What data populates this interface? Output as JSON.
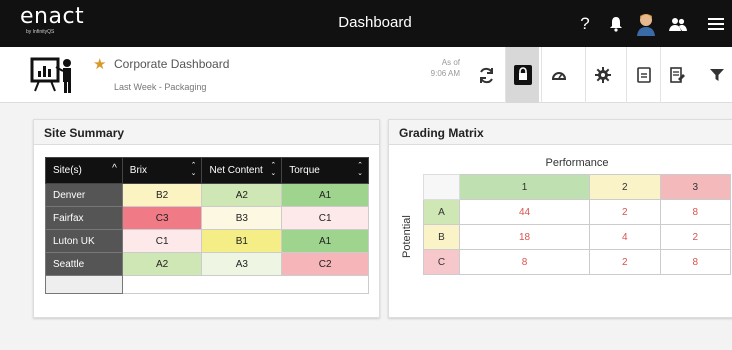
{
  "app": {
    "logo": "enact",
    "logo_sub": "by InfinityQS",
    "title": "Dashboard"
  },
  "top_icons": [
    "help-icon",
    "bell-icon",
    "user-avatar",
    "team-icon",
    "menu-icon"
  ],
  "subheader": {
    "name": "Corporate Dashboard",
    "filter": "Last Week - Packaging",
    "asof_label": "As of",
    "asof_time": "9:06 AM"
  },
  "site_summary": {
    "title": "Site Summary",
    "columns": [
      "Site(s)",
      "Brix",
      "Net Content",
      "Torque"
    ],
    "rows": [
      {
        "site": "Denver",
        "cells": [
          {
            "v": "B2",
            "c": "#fbf3c2"
          },
          {
            "v": "A2",
            "c": "#cfe6b5"
          },
          {
            "v": "A1",
            "c": "#9fd48f"
          }
        ]
      },
      {
        "site": "Fairfax",
        "cells": [
          {
            "v": "C3",
            "c": "#f07b86"
          },
          {
            "v": "B3",
            "c": "#fdf8e2"
          },
          {
            "v": "C1",
            "c": "#fde8ea"
          }
        ]
      },
      {
        "site": "Luton UK",
        "cells": [
          {
            "v": "C1",
            "c": "#fde8ea"
          },
          {
            "v": "B1",
            "c": "#f5ee87"
          },
          {
            "v": "A1",
            "c": "#9fd48f"
          }
        ]
      },
      {
        "site": "Seattle",
        "cells": [
          {
            "v": "A2",
            "c": "#cfe6b5"
          },
          {
            "v": "A3",
            "c": "#eef5e3"
          },
          {
            "v": "C2",
            "c": "#f6b5b9"
          }
        ]
      }
    ]
  },
  "grading_matrix": {
    "title": "Grading Matrix",
    "col_axis": "Performance",
    "row_axis": "Potential",
    "cols": [
      {
        "label": "1",
        "c": "#bfe0b0"
      },
      {
        "label": "2",
        "c": "#fbf3c8"
      },
      {
        "label": "3",
        "c": "#f4b9bb"
      }
    ],
    "rows": [
      {
        "label": "A",
        "c": "#cfe6b5",
        "values": [
          "44",
          "2",
          "8"
        ]
      },
      {
        "label": "B",
        "c": "#fbf3c8",
        "values": [
          "18",
          "4",
          "2"
        ]
      },
      {
        "label": "C",
        "c": "#f6c8cb",
        "values": [
          "8",
          "2",
          "8"
        ]
      }
    ]
  }
}
